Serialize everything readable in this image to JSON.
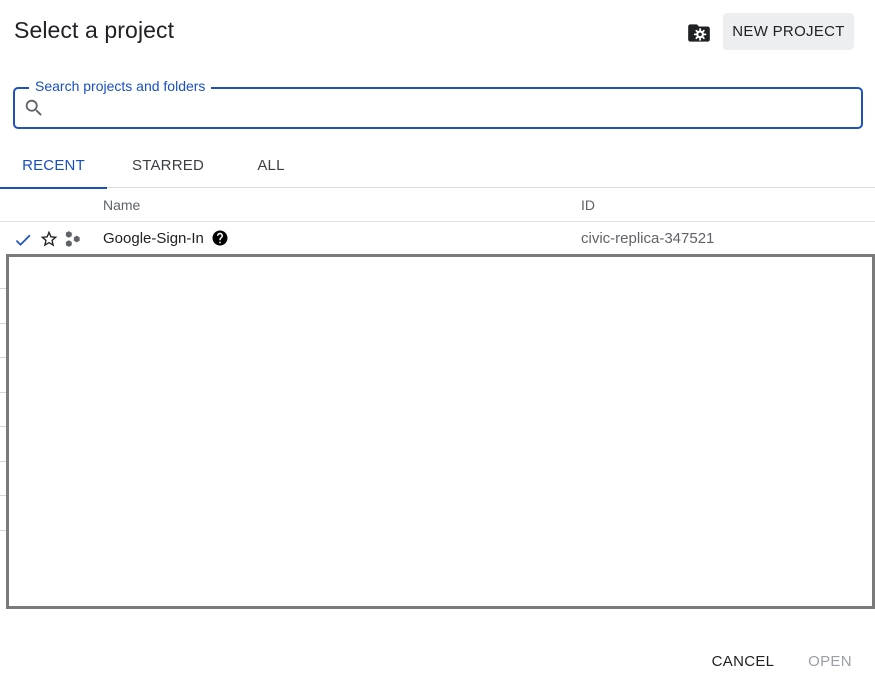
{
  "dialog": {
    "title": "Select a project",
    "new_project_label": "NEW PROJECT"
  },
  "search": {
    "label": "Search projects and folders",
    "value": ""
  },
  "tabs": [
    {
      "label": "RECENT",
      "active": true
    },
    {
      "label": "STARRED",
      "active": false
    },
    {
      "label": "ALL",
      "active": false
    }
  ],
  "table": {
    "columns": {
      "name": "Name",
      "id": "ID"
    },
    "rows": [
      {
        "name": "Google-Sign-In",
        "id": "civic-replica-347521",
        "selected": true,
        "starred": false
      }
    ]
  },
  "footer": {
    "cancel_label": "CANCEL",
    "open_label": "OPEN"
  },
  "colors": {
    "accent": "#1a4fc2",
    "button_bg": "#eceeef",
    "disabled_text": "#9aa0a6"
  },
  "icons": {
    "folder_settings": "folder-settings-icon",
    "search": "search-icon",
    "check": "check-icon",
    "star": "star-outline-icon",
    "project": "project-hexagons-icon",
    "help": "help-circle-icon"
  }
}
